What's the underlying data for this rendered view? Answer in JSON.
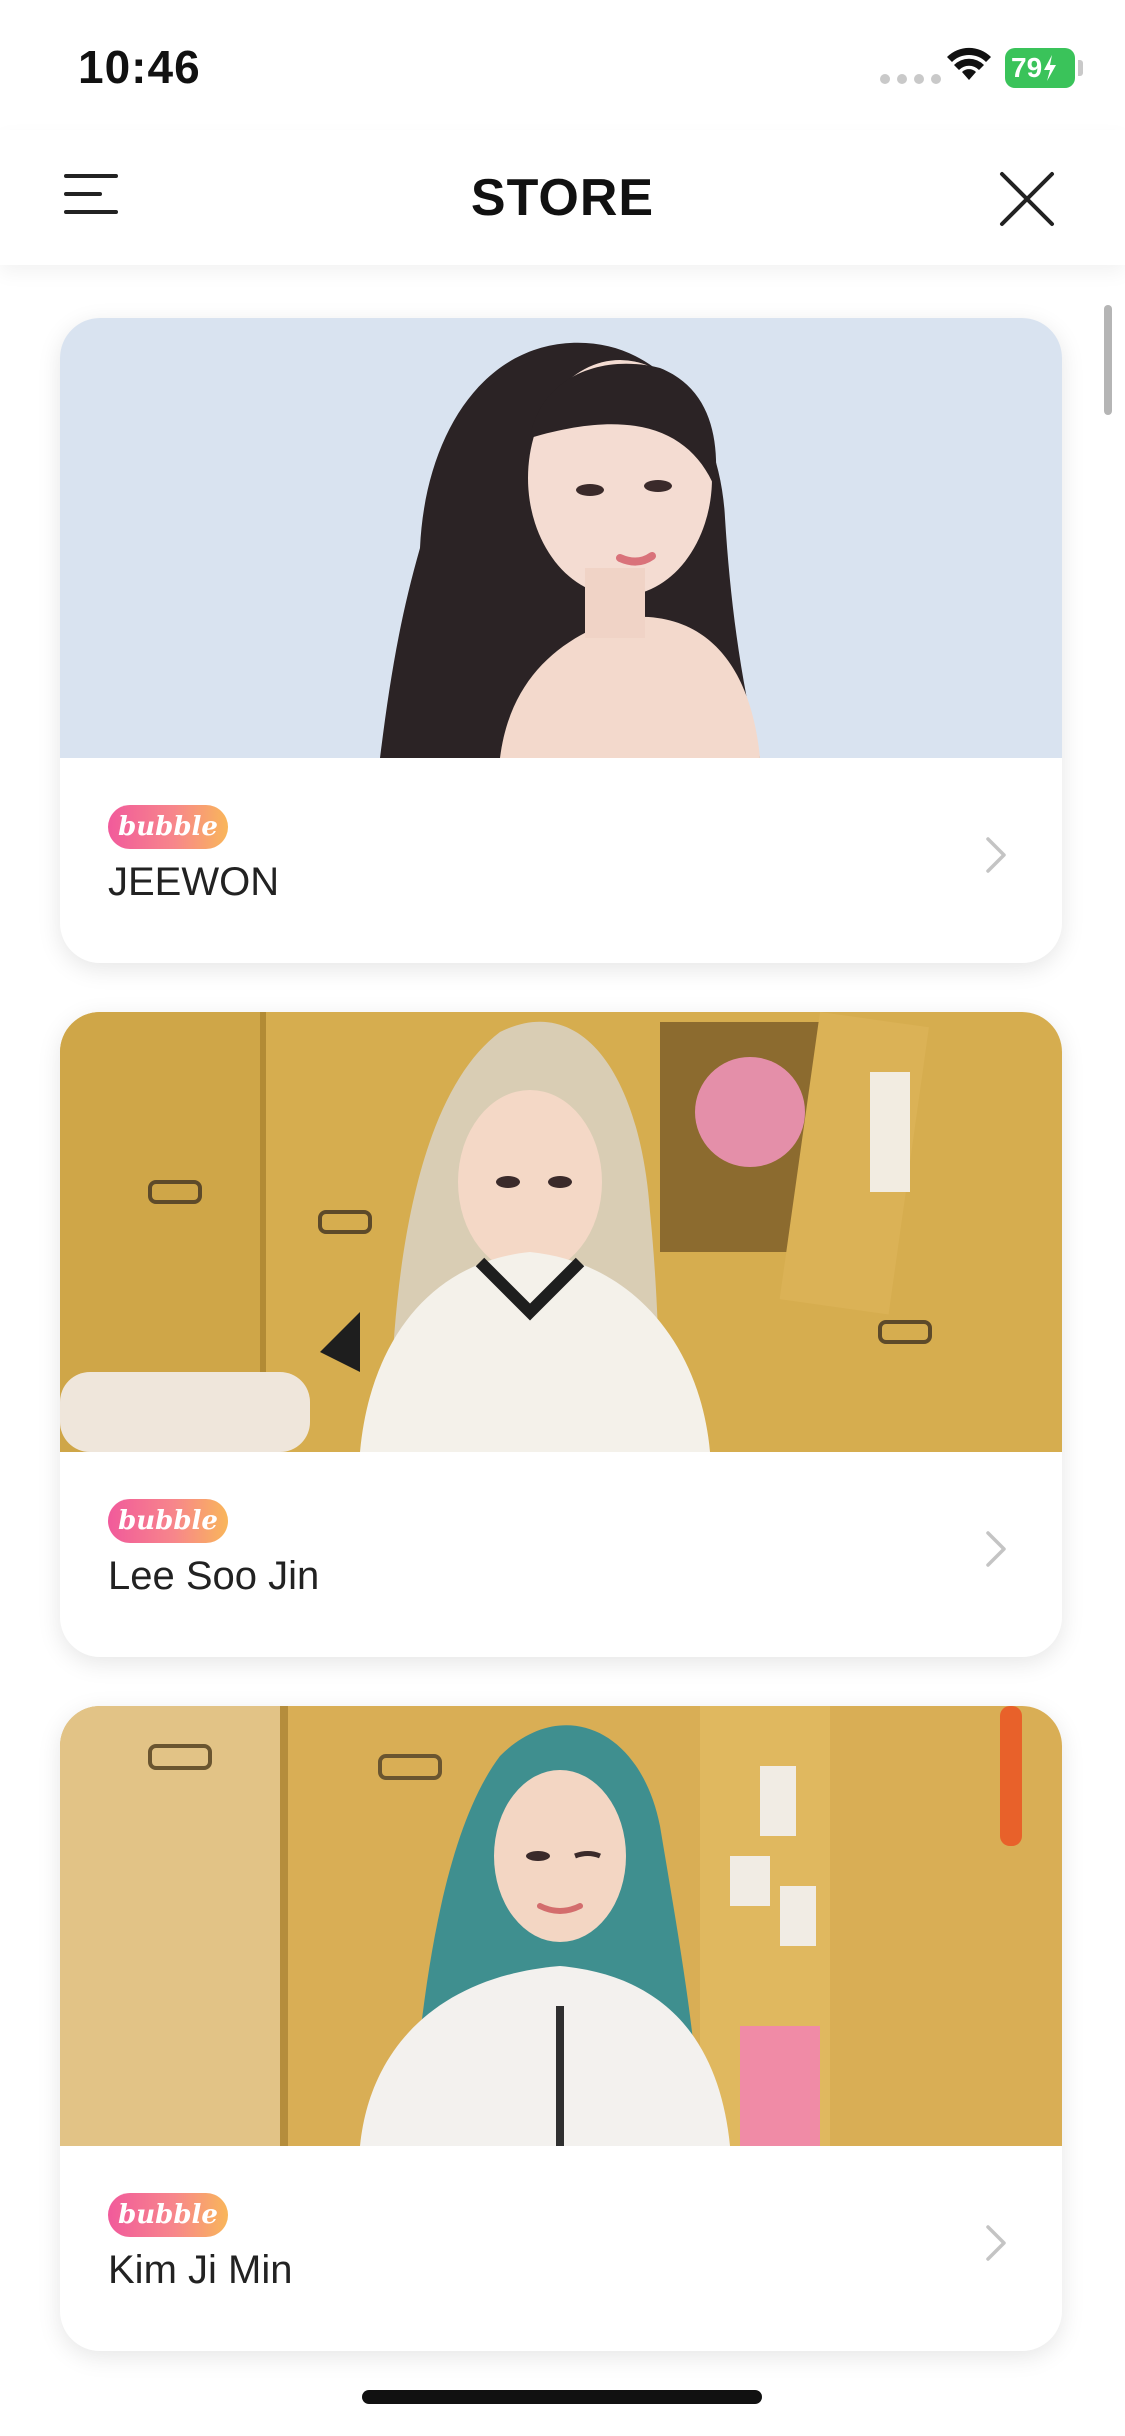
{
  "status_bar": {
    "time": "10:46",
    "battery": "79",
    "icons": [
      "cellular-icon",
      "wifi-icon",
      "battery-charging-icon"
    ]
  },
  "header": {
    "title": "STORE",
    "menu_icon": "hamburger-menu-icon",
    "close_icon": "close-icon"
  },
  "colors": {
    "badge_start": "#f15a9b",
    "badge_end": "#f9b65a",
    "card_bg": "#ffffff"
  },
  "cards": [
    {
      "badge": "bubble",
      "name": "JEEWON",
      "image": "artist-photo-jeewon"
    },
    {
      "badge": "bubble",
      "name": "Lee Soo Jin",
      "image": "artist-photo-lee-soo-jin"
    },
    {
      "badge": "bubble",
      "name": "Kim Ji Min",
      "image": "artist-photo-kim-ji-min"
    }
  ]
}
